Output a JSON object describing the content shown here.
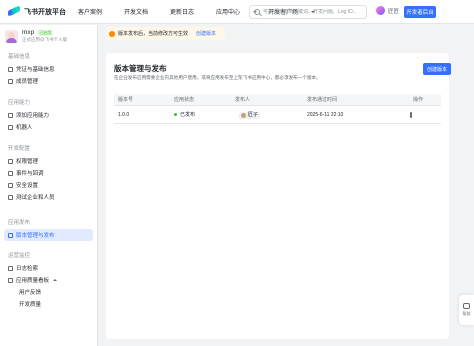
{
  "header": {
    "logo_text": "飞书开放平台",
    "nav": [
      {
        "label": "客户案例",
        "has_caret": false
      },
      {
        "label": "开发文档",
        "has_caret": false
      },
      {
        "label": "更新日志",
        "has_caret": false
      },
      {
        "label": "应用中心",
        "has_caret": true
      },
      {
        "label": "开发者广场",
        "has_caret": true
      }
    ],
    "search_placeholder": "可以输入文档关键词、开发问题、Log ID...",
    "user_name": "匠匠",
    "dev_console_label": "开发者后台"
  },
  "sidebar": {
    "app": {
      "name": "mxp",
      "badge": "已启用",
      "subtitle": "正式应用@飞书个人版"
    },
    "groups": [
      {
        "title": "基础信息",
        "items": [
          {
            "label": "凭证与基础信息",
            "icon": "credential-icon"
          },
          {
            "label": "成员管理",
            "icon": "members-icon"
          }
        ]
      },
      {
        "title": "应用能力",
        "items": [
          {
            "label": "添加应用能力",
            "icon": "add-capability-icon"
          },
          {
            "label": "机器人",
            "icon": "bot-icon"
          }
        ]
      },
      {
        "title": "开发配置",
        "items": [
          {
            "label": "权限管理",
            "icon": "permission-icon"
          },
          {
            "label": "事件与回调",
            "icon": "event-icon"
          },
          {
            "label": "安全设置",
            "icon": "security-icon"
          },
          {
            "label": "测试企业和人员",
            "icon": "test-icon"
          }
        ]
      },
      {
        "title": "应用发布",
        "items": [
          {
            "label": "版本管理与发布",
            "icon": "version-icon",
            "active": true
          }
        ]
      },
      {
        "title": "运营监控",
        "items": [
          {
            "label": "日志检索",
            "icon": "log-icon"
          },
          {
            "label": "应用质量看板",
            "icon": "quality-icon",
            "expanded": true
          },
          {
            "label": "用户反馈",
            "sub": true
          },
          {
            "label": "开发质量",
            "sub": true
          }
        ]
      }
    ]
  },
  "notice": {
    "text": "版本发布后，当前修改方可生效",
    "link": "创建版本"
  },
  "main": {
    "title": "版本管理与发布",
    "description": "在企业发布应用需要企业内其他用户使用，或将应用发布至上架飞书应用中心，都必须发布一个版本。",
    "create_button": "创建版本",
    "columns": [
      "版本号",
      "应用状态",
      "发布人",
      "发布通过时间",
      "操作"
    ],
    "rows": [
      {
        "version": "1.0.0",
        "status": "已发布",
        "publisher": "匠子",
        "time": "2025-6-11 22:10"
      }
    ]
  },
  "help": {
    "label": "帮助"
  },
  "colors": {
    "accent": "#3370ff",
    "success": "#34c724",
    "warning": "#ff8800"
  }
}
